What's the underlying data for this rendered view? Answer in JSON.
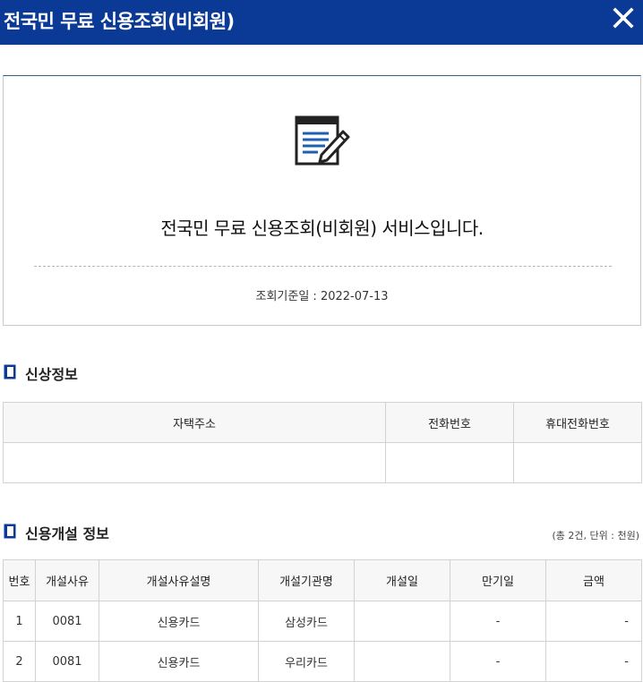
{
  "header": {
    "title": "전국민 무료 신용조회(비회원)",
    "close_label": "X"
  },
  "intro": {
    "message": "전국민 무료 신용조회(비회원) 서비스입니다.",
    "date_label": "조회기준일 : 2022-07-13",
    "icon": "document-edit-icon"
  },
  "personal_info": {
    "title": "신상정보",
    "headers": [
      "자택주소",
      "전화번호",
      "휴대전화번호"
    ],
    "rows": [
      [
        "",
        "",
        ""
      ]
    ]
  },
  "credit_open": {
    "title": "신용개설 정보",
    "summary": "(총 2건, 단위 : 천원)",
    "headers": [
      "번호",
      "개설사유",
      "개설사유설명",
      "개설기관명",
      "개설일",
      "만기일",
      "금액"
    ],
    "rows": [
      [
        "1",
        "0081",
        "신용카드",
        "삼성카드",
        "",
        "-",
        "-"
      ],
      [
        "2",
        "0081",
        "신용카드",
        "우리카드",
        "",
        "-",
        "-"
      ]
    ]
  },
  "colors": {
    "header_bg": "#0a3a96",
    "accent_line": "#2f5e86",
    "icon_blue": "#1e5fb4"
  }
}
